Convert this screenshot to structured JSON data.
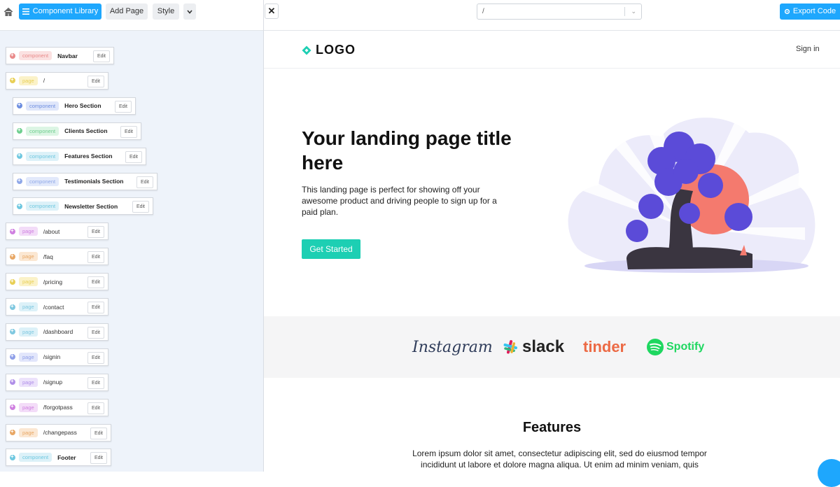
{
  "toolbar": {
    "component_library_label": "Component Library",
    "add_page_label": "Add Page",
    "style_label": "Style",
    "export_label": "Export Code",
    "route_value": "/"
  },
  "tree": {
    "edit_label": "Edit",
    "items": [
      {
        "tag": "component",
        "label": "Navbar",
        "bold": true,
        "color": "#e98a8a",
        "tagbg": "#fbe1e1"
      },
      {
        "tag": "page",
        "label": "/",
        "bold": false,
        "color": "#e8cf55",
        "tagbg": "#fbf2c8"
      },
      {
        "tag": "component",
        "label": "Hero Section",
        "bold": true,
        "color": "#6d8ee0",
        "tagbg": "#dfe6fa"
      },
      {
        "tag": "component",
        "label": "Clients Section",
        "bold": true,
        "color": "#6fcf8f",
        "tagbg": "#dcf5e4"
      },
      {
        "tag": "component",
        "label": "Features Section",
        "bold": true,
        "color": "#6fc8e0",
        "tagbg": "#dcf1f8"
      },
      {
        "tag": "component",
        "label": "Testimonials Section",
        "bold": true,
        "color": "#8fa8e8",
        "tagbg": "#e2e9fb"
      },
      {
        "tag": "component",
        "label": "Newsletter Section",
        "bold": true,
        "color": "#6fc8e0",
        "tagbg": "#dcf1f8"
      },
      {
        "tag": "page",
        "label": "/about",
        "bold": false,
        "color": "#cf7fe0",
        "tagbg": "#f3dcf8"
      },
      {
        "tag": "page",
        "label": "/faq",
        "bold": false,
        "color": "#e8a765",
        "tagbg": "#fbe7d2"
      },
      {
        "tag": "page",
        "label": "/pricing",
        "bold": false,
        "color": "#e8cf55",
        "tagbg": "#fbf2c8"
      },
      {
        "tag": "page",
        "label": "/contact",
        "bold": false,
        "color": "#7fc8e0",
        "tagbg": "#dcf1f8"
      },
      {
        "tag": "page",
        "label": "/dashboard",
        "bold": false,
        "color": "#7fc8e0",
        "tagbg": "#dcf1f8"
      },
      {
        "tag": "page",
        "label": "/signin",
        "bold": false,
        "color": "#8f9fe8",
        "tagbg": "#e2e6fb"
      },
      {
        "tag": "page",
        "label": "/signup",
        "bold": false,
        "color": "#b08fe8",
        "tagbg": "#ece2fb"
      },
      {
        "tag": "page",
        "label": "/forgotpass",
        "bold": false,
        "color": "#cf7fe0",
        "tagbg": "#f3dcf8"
      },
      {
        "tag": "page",
        "label": "/changepass",
        "bold": false,
        "color": "#e8a765",
        "tagbg": "#fbe7d2"
      },
      {
        "tag": "component",
        "label": "Footer",
        "bold": true,
        "color": "#6fc8e0",
        "tagbg": "#dcf1f8"
      }
    ]
  },
  "site": {
    "logo_text": "LOGO",
    "signin_label": "Sign in",
    "hero_title": "Your landing page title here",
    "hero_subtitle": "This landing page is perfect for showing off your awesome product and driving people to sign up for a paid plan.",
    "cta_label": "Get Started",
    "clients": [
      "Instagram",
      "slack",
      "tinder",
      "Spotify"
    ],
    "features_title": "Features",
    "features_text": "Lorem ipsum dolor sit amet, consectetur adipiscing elit, sed do eiusmod tempor incididunt ut labore et dolore magna aliqua. Ut enim ad minim veniam, quis"
  },
  "colors": {
    "accent": "#1ea7fd",
    "cta": "#1dcfb3",
    "logo_mark": "#1dcfb3"
  }
}
